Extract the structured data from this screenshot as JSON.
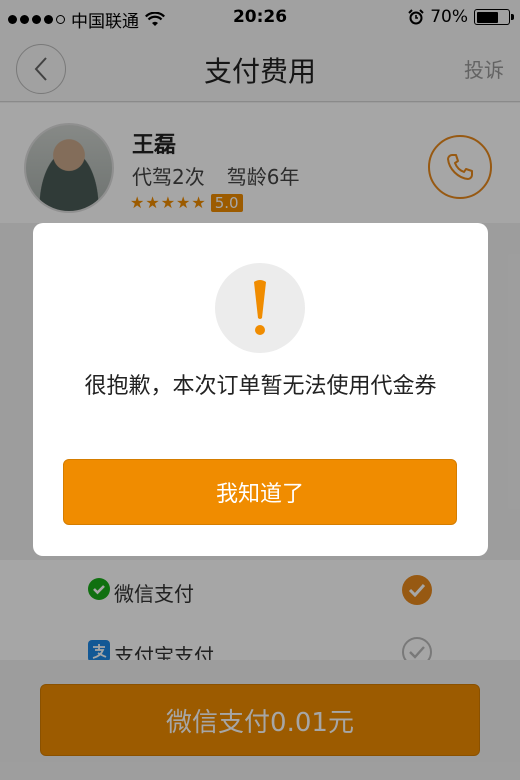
{
  "status_bar": {
    "carrier": "中国联通",
    "time": "20:26",
    "battery": "70%",
    "battery_level": 0.7
  },
  "nav": {
    "title": "支付费用",
    "complain_label": "投诉"
  },
  "driver": {
    "name": "王磊",
    "trips": "代驾2次",
    "experience": "驾龄6年",
    "stars": "★★★★★",
    "score": "5.0"
  },
  "payment": {
    "options": [
      {
        "label": "微信支付",
        "icon": "wechat-icon",
        "selected": true
      },
      {
        "label": "支付宝支付",
        "icon": "alipay-icon",
        "selected": false
      }
    ],
    "pay_button_label": "微信支付0.01元"
  },
  "dialog": {
    "icon": "exclamation-icon",
    "message": "很抱歉，本次订单暂无法使用代金券",
    "ok_label": "我知道了"
  },
  "colors": {
    "accent": "#f08c00",
    "wechat": "#1aad19",
    "alipay": "#1e88e5"
  }
}
